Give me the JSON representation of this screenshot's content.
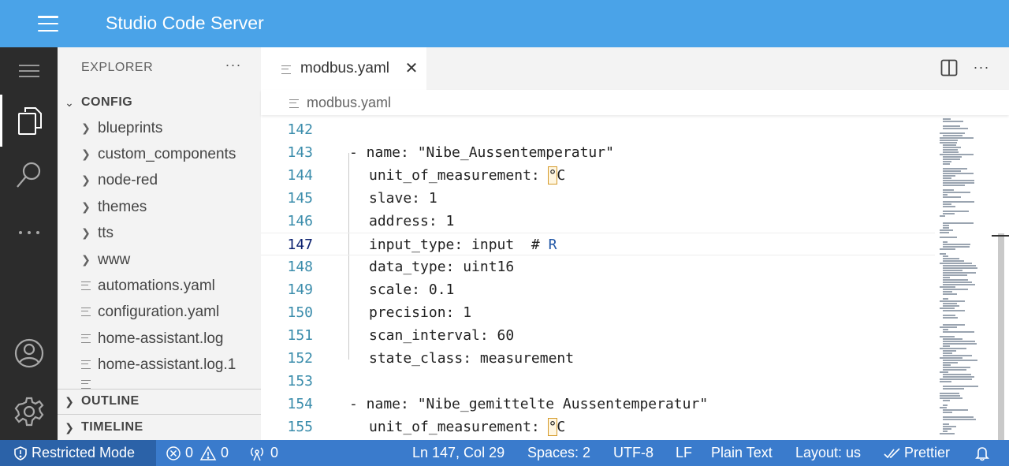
{
  "app": {
    "title": "Studio Code Server"
  },
  "sidebar": {
    "header": "EXPLORER",
    "more": "···",
    "config_section": "CONFIG",
    "folders": [
      "blueprints",
      "custom_components",
      "node-red",
      "themes",
      "tts",
      "www"
    ],
    "files": [
      "automations.yaml",
      "configuration.yaml",
      "home-assistant.log",
      "home-assistant.log.1"
    ],
    "outline": "OUTLINE",
    "timeline": "TIMELINE"
  },
  "editor": {
    "tab_name": "modbus.yaml",
    "breadcrumb": "modbus.yaml",
    "more": "···",
    "lines": [
      {
        "n": "142",
        "text": ""
      },
      {
        "n": "143",
        "text": "- name: \"Nibe_Aussentemperatur\""
      },
      {
        "n": "144",
        "pre": "unit_of_measurement: ",
        "hl": "°",
        "post": "C"
      },
      {
        "n": "145",
        "text": "slave: 1"
      },
      {
        "n": "146",
        "text": "address: 1"
      },
      {
        "n": "147",
        "pre": "input_type: input  # ",
        "r": "R"
      },
      {
        "n": "148",
        "text": "data_type: uint16"
      },
      {
        "n": "149",
        "text": "scale: 0.1"
      },
      {
        "n": "150",
        "text": "precision: 1"
      },
      {
        "n": "151",
        "text": "scan_interval: 60"
      },
      {
        "n": "152",
        "text": "state_class: measurement"
      },
      {
        "n": "153",
        "text": ""
      },
      {
        "n": "154",
        "text": "- name: \"Nibe_gemittelte Aussentemperatur\""
      },
      {
        "n": "155",
        "pre": "unit_of_measurement: ",
        "hl": "°",
        "post": "C"
      }
    ]
  },
  "status": {
    "restricted": "Restricted Mode",
    "errors": "0",
    "warnings": "0",
    "ports": "0",
    "position": "Ln 147, Col 29",
    "spaces": "Spaces: 2",
    "encoding": "UTF-8",
    "eol": "LF",
    "language": "Plain Text",
    "layout": "Layout: us",
    "prettier": "Prettier"
  }
}
